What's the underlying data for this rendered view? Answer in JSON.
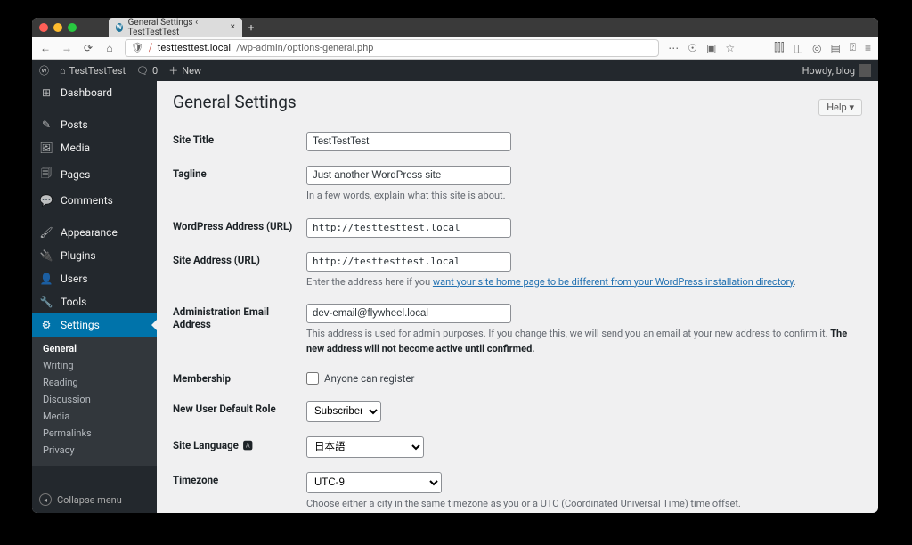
{
  "browser": {
    "tab_title": "General Settings ‹ TestTestTest",
    "url_host": "testtesttest.local",
    "url_path": "/wp-admin/options-general.php"
  },
  "adminbar": {
    "site_name": "TestTestTest",
    "comment_count": "0",
    "new_label": "New",
    "howdy": "Howdy, blog"
  },
  "sidebar": {
    "items": [
      {
        "icon": "🏠",
        "label": "Dashboard"
      },
      {
        "icon": "📌",
        "label": "Posts"
      },
      {
        "icon": "🎞",
        "label": "Media"
      },
      {
        "icon": "📄",
        "label": "Pages"
      },
      {
        "icon": "💬",
        "label": "Comments"
      },
      {
        "icon": "🖌",
        "label": "Appearance"
      },
      {
        "icon": "🔌",
        "label": "Plugins"
      },
      {
        "icon": "👤",
        "label": "Users"
      },
      {
        "icon": "🔧",
        "label": "Tools"
      },
      {
        "icon": "⚙",
        "label": "Settings"
      }
    ],
    "submenu": [
      "General",
      "Writing",
      "Reading",
      "Discussion",
      "Media",
      "Permalinks",
      "Privacy"
    ],
    "collapse": "Collapse menu"
  },
  "page": {
    "title": "General Settings",
    "help": "Help ▾",
    "fields": {
      "site_title_label": "Site Title",
      "site_title_value": "TestTestTest",
      "tagline_label": "Tagline",
      "tagline_value": "Just another WordPress site",
      "tagline_desc": "In a few words, explain what this site is about.",
      "wp_url_label": "WordPress Address (URL)",
      "wp_url_value": "http://testtesttest.local",
      "site_url_label": "Site Address (URL)",
      "site_url_value": "http://testtesttest.local",
      "site_url_desc_pre": "Enter the address here if you ",
      "site_url_desc_link": "want your site home page to be different from your WordPress installation directory",
      "admin_email_label": "Administration Email Address",
      "admin_email_value": "dev-email@flywheel.local",
      "admin_email_desc_a": "This address is used for admin purposes. If you change this, we will send you an email at your new address to confirm it. ",
      "admin_email_desc_b": "The new address will not become active until confirmed.",
      "membership_label": "Membership",
      "membership_chk": "Anyone can register",
      "new_role_label": "New User Default Role",
      "new_role_value": "Subscriber",
      "lang_label": "Site Language",
      "lang_value": "日本語",
      "tz_label": "Timezone",
      "tz_value": "UTC-9",
      "tz_desc": "Choose either a city in the same timezone as you or a UTC (Coordinated Universal Time) time offset."
    }
  }
}
